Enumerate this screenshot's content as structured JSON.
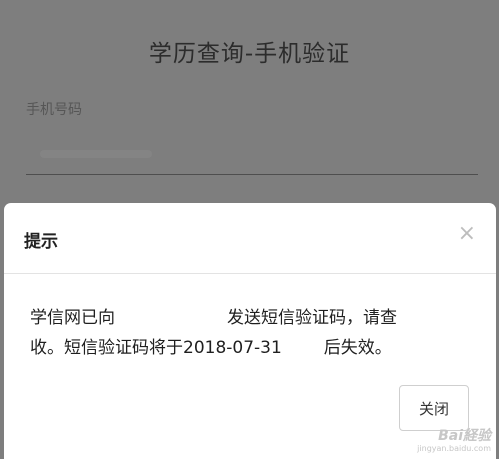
{
  "background": {
    "title": "学历查询-手机验证",
    "field_label": "手机号码"
  },
  "dialog": {
    "title": "提示",
    "close_icon": "×",
    "message_line1_a": "学信网已向",
    "message_line1_b": "发送短信验证码，请查",
    "message_line2_a": "收。短信验证码将于2018-07-31",
    "message_line2_b": "后失效。",
    "close_button_label": "关闭"
  },
  "watermark": {
    "logo": "Bai経验",
    "url": "jingyan.baidu.com"
  },
  "colors": {
    "overlay_bg": "#7e7e7e",
    "dialog_bg": "#ffffff",
    "text": "#1f1f1f"
  }
}
